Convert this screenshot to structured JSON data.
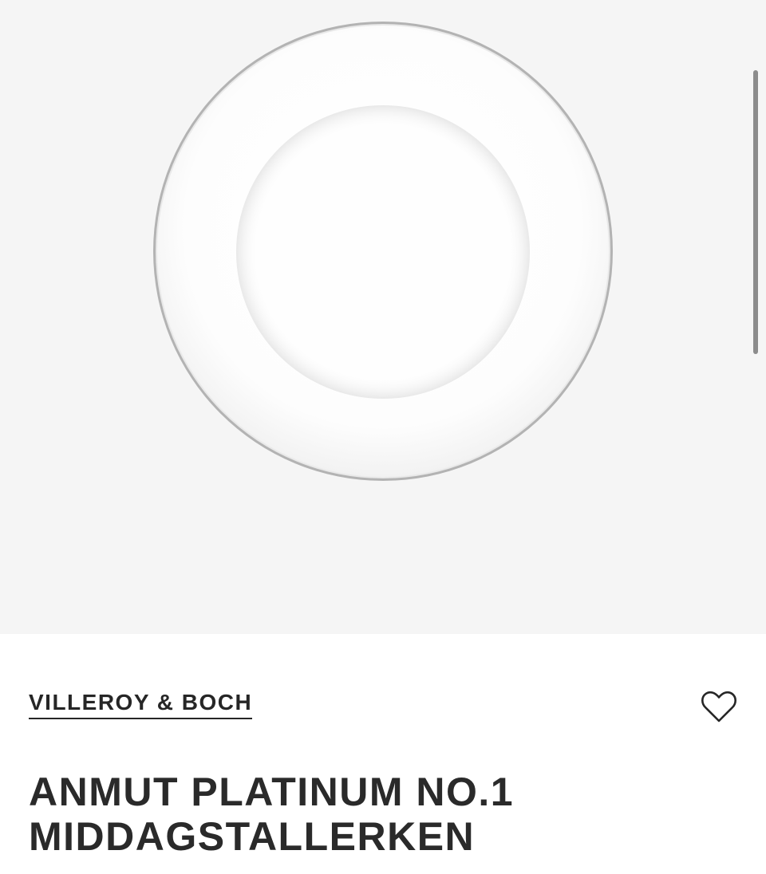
{
  "product": {
    "brand": "VILLEROY & BOCH",
    "title_line_1": "ANMUT PLATINUM NO.1",
    "title_line_2": "MIDDAGSTALLERKEN"
  },
  "icons": {
    "favorite": "heart-outline-icon"
  },
  "colors": {
    "gallery_background": "#f5f5f5",
    "plate_white": "#ffffff",
    "plate_rim": "#a7a7a7",
    "text": "#2b2b2b"
  }
}
